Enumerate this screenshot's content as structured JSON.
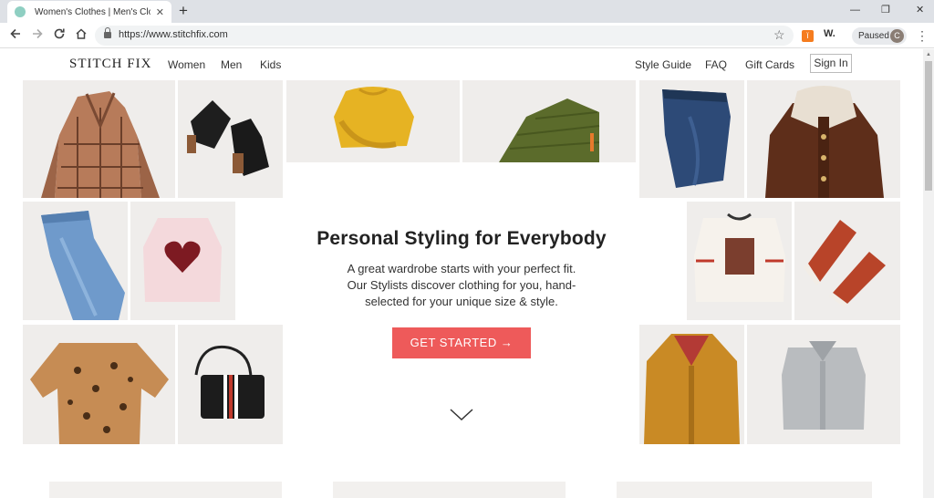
{
  "browser": {
    "tab_title": "Women's Clothes | Men's Clothes",
    "tab_close": "✕",
    "new_tab": "+",
    "url": "https://www.stitchfix.com",
    "profile_status": "Paused",
    "profile_initial": "C",
    "extension_label": "W.",
    "window_controls": [
      "—",
      "❐",
      "✕"
    ],
    "nav_icons": [
      "back-arrow",
      "forward-arrow",
      "reload",
      "home"
    ]
  },
  "header": {
    "logo": "STITCH FIX",
    "nav_left": [
      "Women",
      "Men",
      "Kids"
    ],
    "nav_right": [
      "Style Guide",
      "FAQ",
      "Gift Cards"
    ],
    "sign_in": "Sign In"
  },
  "hero": {
    "title": "Personal Styling for Everybody",
    "body_lines": [
      "A great wardrobe starts with your perfect fit.",
      "Our Stylists discover clothing for you, hand-",
      "selected for your unique size & style."
    ],
    "cta": "GET STARTED →"
  },
  "tiles": [
    "plaid-coat",
    "black-boots",
    "yellow-sweater",
    "green-puffer-jacket",
    "dark-jeans",
    "brown-corduroy-jacket",
    "light-jeans",
    "heart-sweater",
    "graphic-tee",
    "red-sneakers",
    "leopard-top",
    "black-crossbody-bag",
    "mustard-jacket",
    "grey-shirt"
  ],
  "colors": {
    "accent": "#ee5a5a",
    "tile_bg": "#efedeb"
  }
}
